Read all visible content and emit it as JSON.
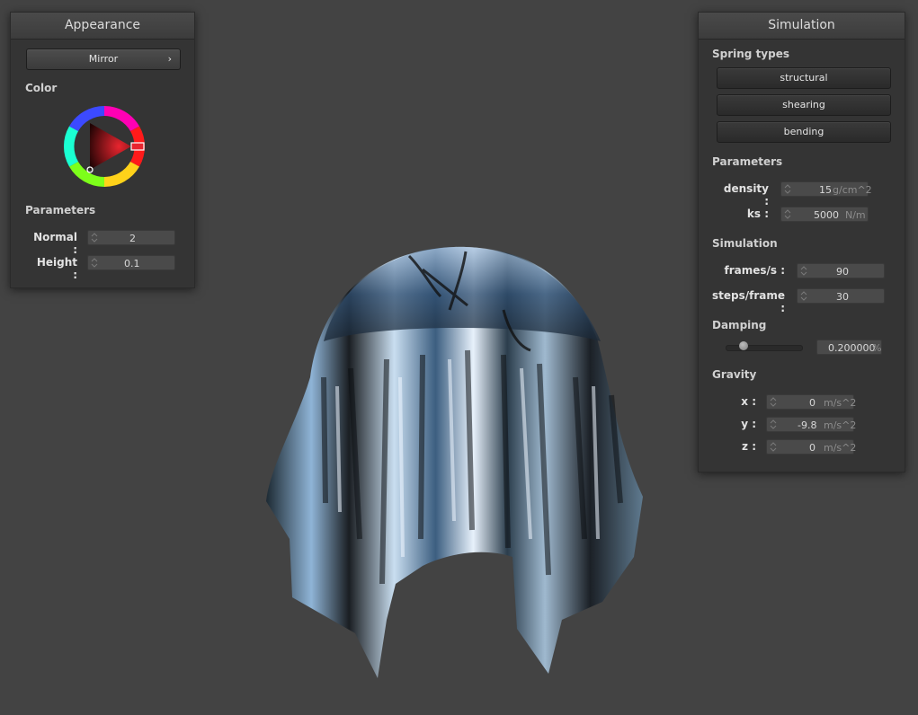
{
  "appearance": {
    "title": "Appearance",
    "shader_label": "Mirror",
    "shader_chevron": "›",
    "color_label": "Color",
    "parameters_label": "Parameters",
    "normal_label": "Normal :",
    "normal_value": "2",
    "height_label": "Height :",
    "height_value": "0.1",
    "selected_color": "#e8252f"
  },
  "simulation": {
    "title": "Simulation",
    "spring_types_label": "Spring types",
    "spring_types": [
      "structural",
      "shearing",
      "bending"
    ],
    "parameters_label": "Parameters",
    "density_label": "density :",
    "density_value": "15",
    "density_unit": "g/cm^2",
    "ks_label": "ks :",
    "ks_value": "5000",
    "ks_unit": "N/m",
    "simulation_label": "Simulation",
    "fps_label": "frames/s :",
    "fps_value": "90",
    "steps_label": "steps/frame :",
    "steps_value": "30",
    "damping_label": "Damping",
    "damping_value": "0.200000",
    "damping_unit": "%",
    "damping_fraction": 0.2,
    "gravity_label": "Gravity",
    "gx_label": "x :",
    "gx_value": "0",
    "gy_label": "y :",
    "gy_value": "-9.8",
    "gz_label": "z :",
    "gz_value": "0",
    "gravity_unit": "m/s^2"
  }
}
